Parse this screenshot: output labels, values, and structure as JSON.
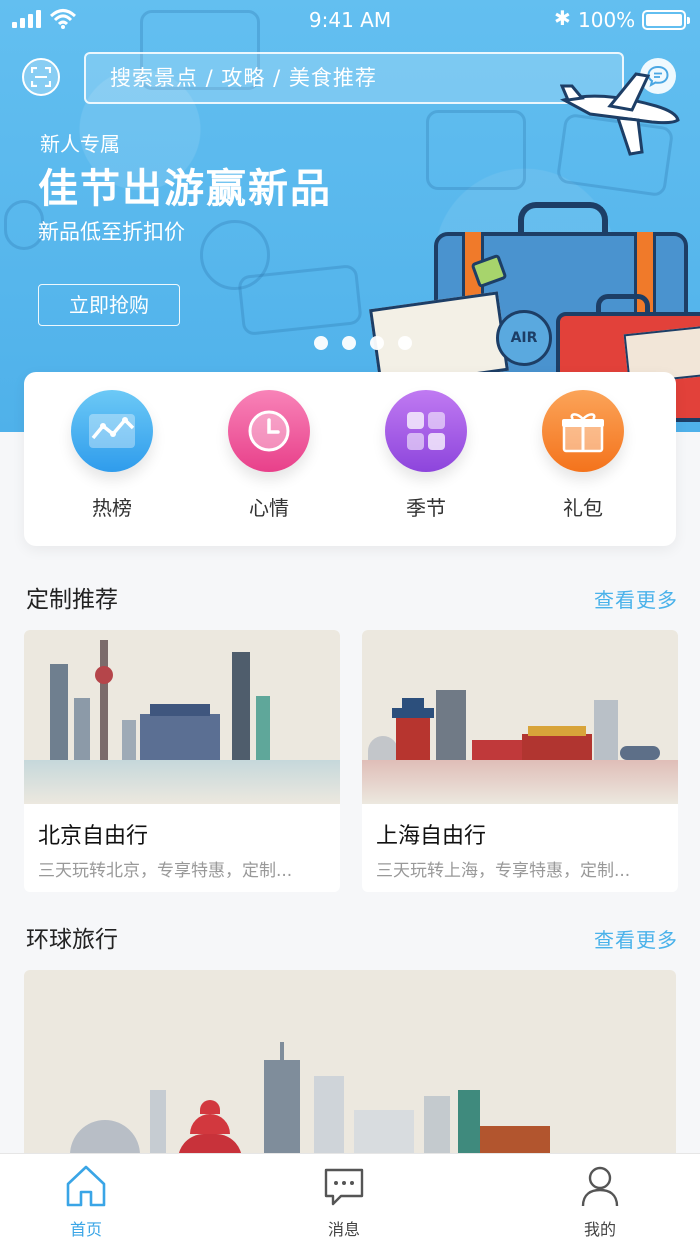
{
  "status_bar": {
    "time": "9:41 AM",
    "battery": "100%"
  },
  "search": {
    "placeholder": "搜索景点 / 攻略 / 美食推荐"
  },
  "banner": {
    "tag": "新人专属",
    "title": "佳节出游赢新品",
    "subtitle": "新品低至折扣价",
    "cta": "立即抢购",
    "slide_count": 4,
    "active_slide": 4
  },
  "categories": [
    {
      "label": "热榜",
      "icon": "trend-chart-icon",
      "color": "#3aa8ef"
    },
    {
      "label": "心情",
      "icon": "clock-icon",
      "color": "#ef5aa0"
    },
    {
      "label": "季节",
      "icon": "grid-icon",
      "color": "#a45ce6"
    },
    {
      "label": "礼包",
      "icon": "gift-icon",
      "color": "#f88a36"
    }
  ],
  "custom_section": {
    "title": "定制推荐",
    "more": "查看更多",
    "cards": [
      {
        "name": "北京自由行",
        "desc": "三天玩转北京，专享特惠，定制..."
      },
      {
        "name": "上海自由行",
        "desc": "三天玩转上海，专享特惠，定制..."
      }
    ]
  },
  "global_section": {
    "title": "环球旅行",
    "more": "查看更多"
  },
  "tabbar": [
    {
      "label": "首页",
      "icon": "home-icon",
      "active": true
    },
    {
      "label": "消息",
      "icon": "chat-icon",
      "active": false
    },
    {
      "label": "我的",
      "icon": "user-icon",
      "active": false
    }
  ],
  "colors": {
    "accent": "#3aa5e6",
    "hero": "#55b5ec",
    "background": "#f6f7f9"
  }
}
